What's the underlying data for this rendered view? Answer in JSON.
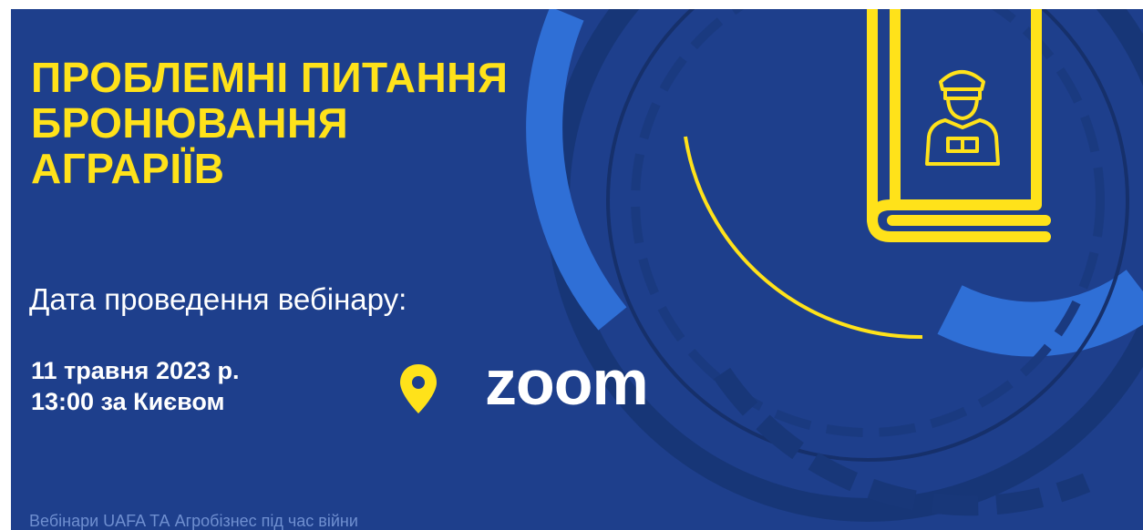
{
  "banner": {
    "title_lines": [
      "ПРОБЛЕМНІ ПИТАННЯ",
      "БРОНЮВАННЯ",
      "АГРАРІЇВ"
    ],
    "date_label": "Дата проведення вебінару:",
    "date": "11 травня 2023 р.",
    "time": "13:00 за Києвом",
    "platform": "zoom",
    "footer": "Вебінари UAFA ТА Агробізнес під час війни"
  },
  "colors": {
    "background": "#1e3f8c",
    "accent_yellow": "#ffe21a",
    "accent_blue": "#2f6fd6",
    "text": "#ffffff"
  },
  "icons": [
    "map-pin-icon",
    "book-soldier-icon"
  ]
}
